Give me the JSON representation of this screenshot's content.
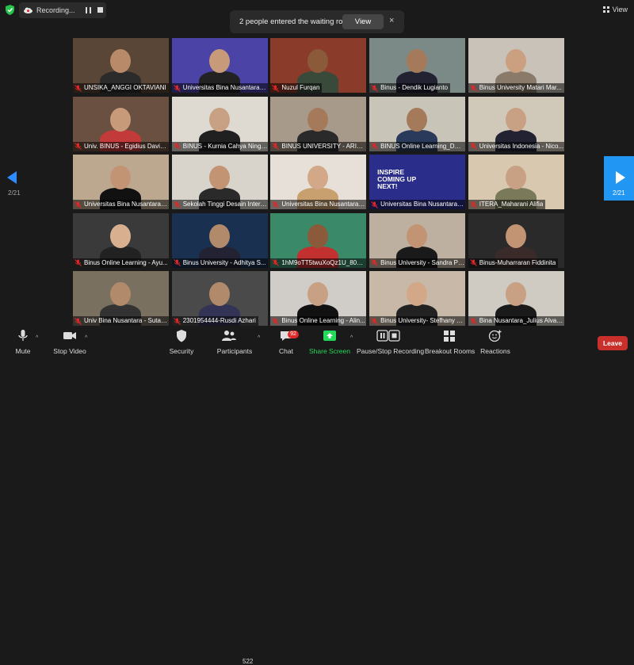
{
  "recording": {
    "label": "Recording..."
  },
  "view_menu": {
    "label": "View"
  },
  "waiting_notice": {
    "text": "2 people entered the waiting room",
    "view_button": "View",
    "close": "×"
  },
  "pagination": {
    "left": "2/21",
    "right": "2/21"
  },
  "participants": [
    {
      "name": "UNSIKA_ANGGI OKTAVIANI",
      "bg": "#5a4636",
      "skin": "#b88a6a",
      "shirt": "#2b2b2b"
    },
    {
      "name": "Universitas Bina Nusantara - ...",
      "bg": "#4b44a6",
      "skin": "#c79a7a",
      "shirt": "#222"
    },
    {
      "name": "Nuzul Furqan",
      "bg": "#8a3b2a",
      "skin": "#8a5a3a",
      "shirt": "#3a4a3a"
    },
    {
      "name": "Binus - Dendik Lugianto",
      "bg": "#7b8a86",
      "skin": "#a57a5a",
      "shirt": "#223"
    },
    {
      "name": "Binus University Matari Mar...",
      "bg": "#c8c2b8",
      "skin": "#caa080",
      "shirt": "#8a7a6a"
    },
    {
      "name": "Univ. BINUS - Egidius David ...",
      "bg": "#6a5040",
      "skin": "#c79a7a",
      "shirt": "#c23a3a"
    },
    {
      "name": "BINUS - Kurnia Cahya Nings...",
      "bg": "#dedad2",
      "skin": "#c8a084",
      "shirt": "#202020"
    },
    {
      "name": "BINUS UNIVERSITY - ARIEF ...",
      "bg": "#a89a8a",
      "skin": "#a57a5a",
      "shirt": "#2a2a2a"
    },
    {
      "name": "BINUS Online Learning_Dwi ...",
      "bg": "#c8c4b8",
      "skin": "#a57a5a",
      "shirt": "#2a3a5a"
    },
    {
      "name": "Universitas Indonesia - Nico...",
      "bg": "#d0c8b8",
      "skin": "#c8a084",
      "shirt": "#223"
    },
    {
      "name": "Universitas Bina Nusantara - ...",
      "bg": "#bba88e",
      "skin": "#c29474",
      "shirt": "#111"
    },
    {
      "name": "Sekolah Tinggi Desain Inters...",
      "bg": "#d8d4cc",
      "skin": "#c29474",
      "shirt": "#2a2a2a"
    },
    {
      "name": "Universitas Bina Nusantara - ...",
      "bg": "#e6e0d8",
      "skin": "#d2a888",
      "shirt": "#c8a070"
    },
    {
      "name": "Universitas Bina Nusantara - ...",
      "bg": "#2a2d8a",
      "skin": "#2a2d8a",
      "shirt": "#2a2d8a",
      "banner": "INSPIRE COMING UP NEXT!"
    },
    {
      "name": "ITERA_Maharani Alifia",
      "bg": "#d8c8b0",
      "skin": "#c8a084",
      "shirt": "#7a7a5a"
    },
    {
      "name": "Binus Online Learning - Ayu...",
      "bg": "#3a3a3a",
      "skin": "#d8b090",
      "shirt": "#222"
    },
    {
      "name": "Binus University - Adhitya S...",
      "bg": "#1a3050",
      "skin": "#b08a6a",
      "shirt": "#223"
    },
    {
      "name": "1hM9oTT5twuXoQz1U_8015...",
      "bg": "#3a8a6a",
      "skin": "#8a5a3a",
      "shirt": "#c23030"
    },
    {
      "name": "Binus University - Sandra Pu...",
      "bg": "#bdb0a0",
      "skin": "#c29474",
      "shirt": "#1a1a1a"
    },
    {
      "name": "Binus-Muharraran Fiddinita",
      "bg": "#2a2a2a",
      "skin": "#c29474",
      "shirt": "#3a2a2a"
    },
    {
      "name": "Univ Bina Nusantara - Sutan...",
      "bg": "#7a7060",
      "skin": "#b08a6a",
      "shirt": "#333"
    },
    {
      "name": "2301954444-Rusdi Azhari",
      "bg": "#4a4a4a",
      "skin": "#b08a6a",
      "shirt": "#335"
    },
    {
      "name": "Binus Online Learning - Alin...",
      "bg": "#d0ccc8",
      "skin": "#c8a084",
      "shirt": "#111"
    },
    {
      "name": "Binus University- Stefhany N...",
      "bg": "#c8b8a8",
      "skin": "#d2a888",
      "shirt": "#222"
    },
    {
      "name": "Bina Nusantara_Julius Alvan...",
      "bg": "#cfcac2",
      "skin": "#c8a084",
      "shirt": "#1a1a1a"
    }
  ],
  "toolbar": {
    "mute": "Mute",
    "stop_video": "Stop Video",
    "security": "Security",
    "participants": "Participants",
    "participant_count": "522",
    "chat": "Chat",
    "chat_badge": "92",
    "share_screen": "Share Screen",
    "pause_recording": "Pause/Stop Recording",
    "breakout_rooms": "Breakout Rooms",
    "reactions": "Reactions",
    "leave": "Leave"
  },
  "colors": {
    "accent": "#2d8cff",
    "share": "#23d959",
    "leave": "#c9302c",
    "mic_off": "#e02828"
  }
}
